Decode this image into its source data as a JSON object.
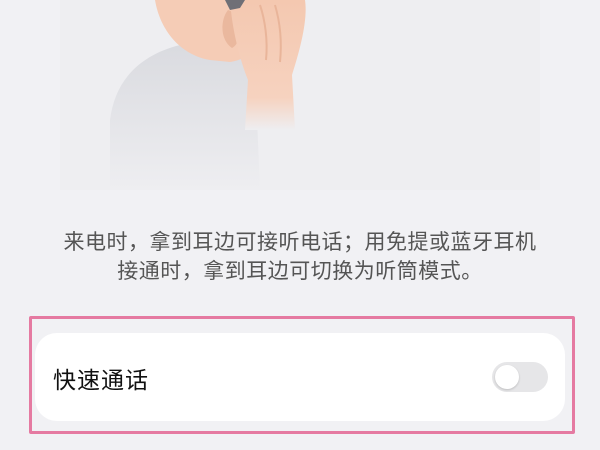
{
  "description": {
    "line1": "来电时，拿到耳边可接听电话；用免提或蓝牙耳机",
    "line2": "接通时，拿到耳边可切换为听筒模式。"
  },
  "quick_call": {
    "label": "快速通话",
    "toggle_on": false
  },
  "colors": {
    "background": "#f1f1f4",
    "highlight_border": "#e57aa1",
    "toggle_off": "#e6e6e8"
  }
}
